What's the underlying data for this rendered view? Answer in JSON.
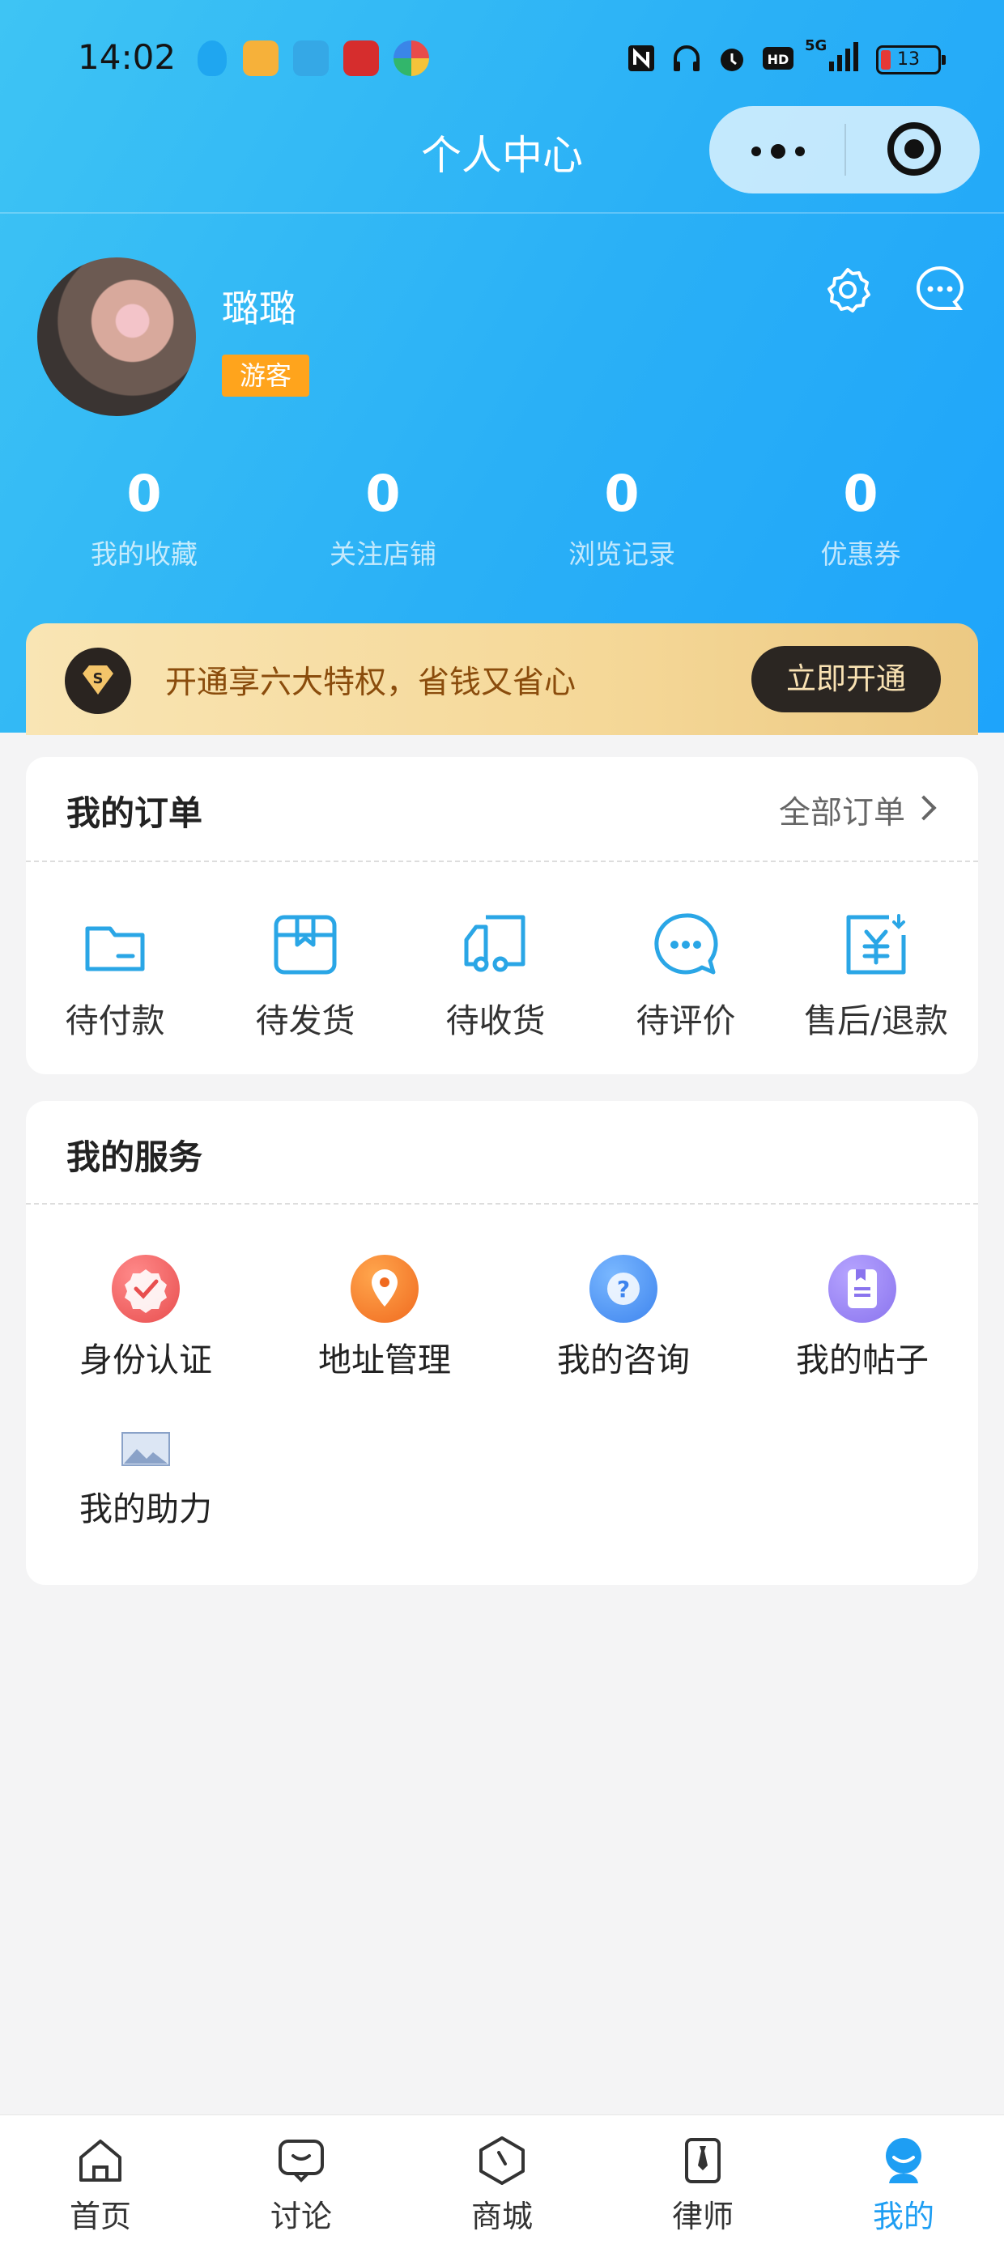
{
  "status_bar": {
    "time": "14:02",
    "battery": "13",
    "network": "5G",
    "icons": [
      "qq-icon",
      "weibo-icon",
      "telegram-icon",
      "app-icon",
      "colorful-app-icon",
      "nfc-icon",
      "headphones-icon",
      "alarm-icon",
      "hd-icon",
      "signal-icon",
      "battery-icon"
    ]
  },
  "nav": {
    "title": "个人中心",
    "capsule_icons": [
      "more-icon",
      "close-icon"
    ]
  },
  "profile": {
    "username": "璐璐",
    "role": "游客",
    "icons": [
      "settings-icon",
      "message-icon"
    ]
  },
  "stats": [
    {
      "value": "0",
      "label": "我的收藏"
    },
    {
      "value": "0",
      "label": "关注店铺"
    },
    {
      "value": "0",
      "label": "浏览记录"
    },
    {
      "value": "0",
      "label": "优惠券"
    }
  ],
  "vip": {
    "text": "开通享六大特权，省钱又省心",
    "button": "立即开通",
    "icon": "diamond-icon"
  },
  "orders": {
    "title": "我的订单",
    "more": "全部订单",
    "items": [
      {
        "label": "待付款",
        "icon": "wallet-icon"
      },
      {
        "label": "待发货",
        "icon": "box-icon"
      },
      {
        "label": "待收货",
        "icon": "truck-icon"
      },
      {
        "label": "待评价",
        "icon": "comment-icon"
      },
      {
        "label": "售后/退款",
        "icon": "refund-icon"
      }
    ]
  },
  "services": {
    "title": "我的服务",
    "items": [
      {
        "label": "身份认证",
        "icon": "verify-icon"
      },
      {
        "label": "地址管理",
        "icon": "location-icon"
      },
      {
        "label": "我的咨询",
        "icon": "question-icon"
      },
      {
        "label": "我的帖子",
        "icon": "post-icon"
      },
      {
        "label": "我的助力",
        "icon": "image-icon"
      }
    ]
  },
  "tabbar": {
    "items": [
      {
        "label": "首页",
        "icon": "home-icon"
      },
      {
        "label": "讨论",
        "icon": "chat-icon"
      },
      {
        "label": "商城",
        "icon": "mall-icon"
      },
      {
        "label": "律师",
        "icon": "lawyer-icon"
      },
      {
        "label": "我的",
        "icon": "user-icon"
      }
    ],
    "active_color": "#1e9ef3"
  },
  "colors": {
    "header": "#2ab0f6",
    "badge": "#ffa41c",
    "vip_text": "#8a4c0c",
    "icon_blue": "#2aa6e6"
  }
}
